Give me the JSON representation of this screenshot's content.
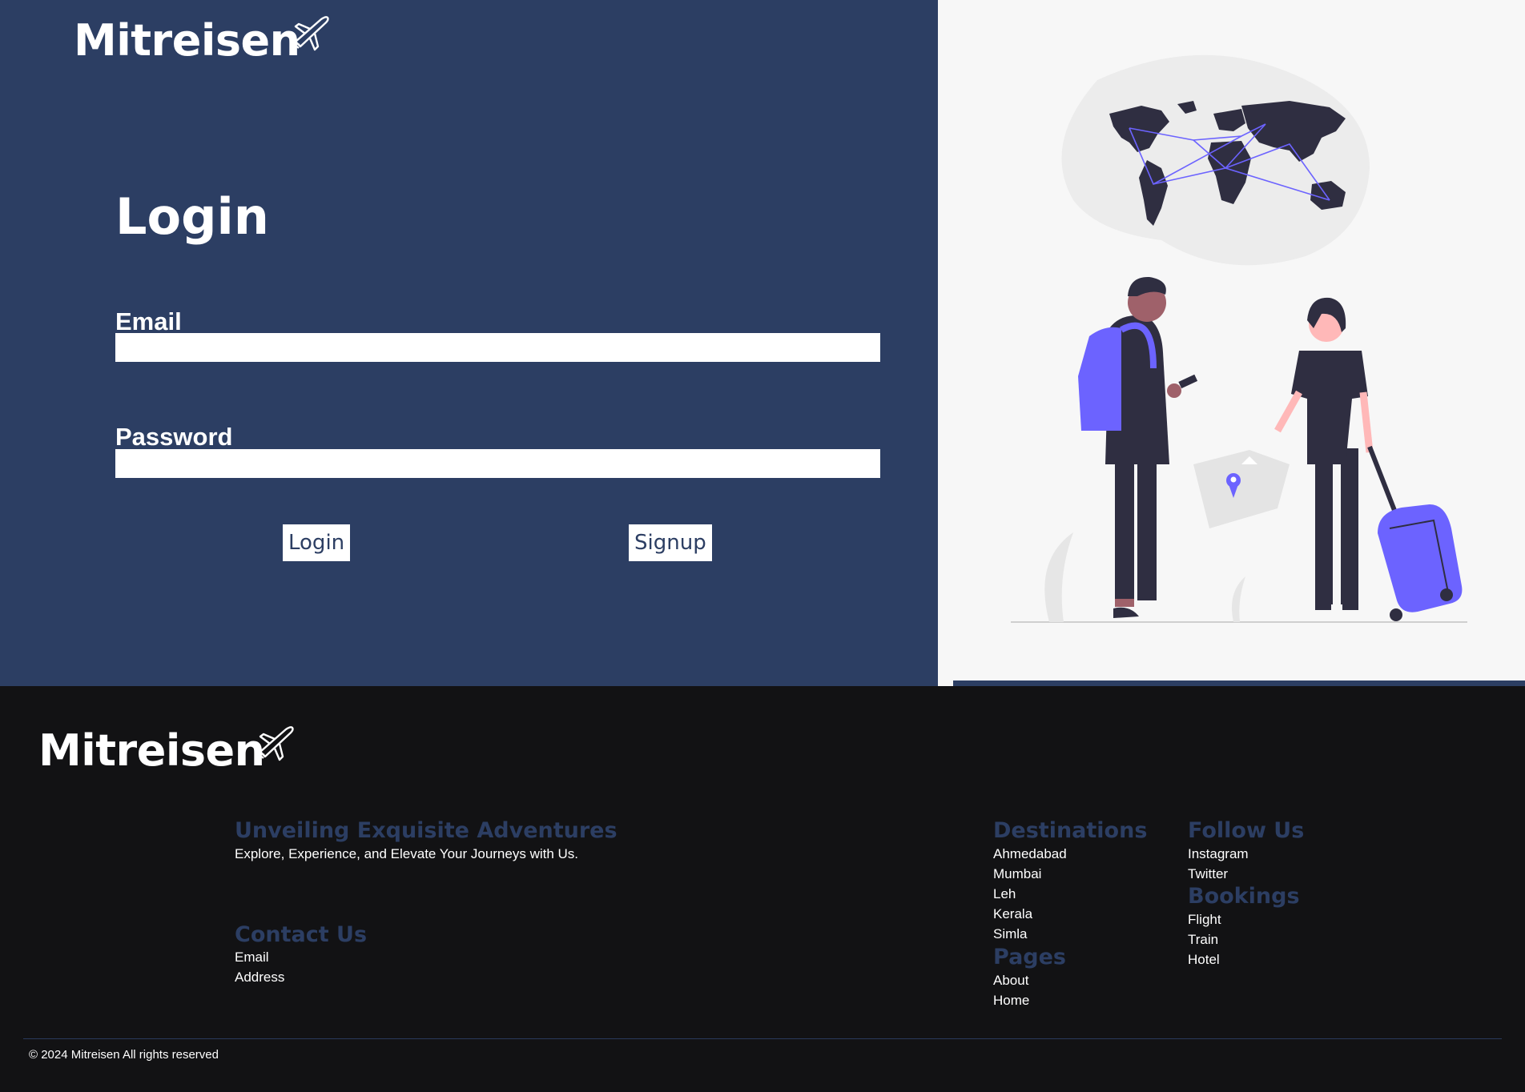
{
  "brand": {
    "name": "Mitreisen"
  },
  "login": {
    "title": "Login",
    "email_label": "Email",
    "email_value": "",
    "password_label": "Password",
    "password_value": "",
    "login_button": "Login",
    "signup_button": "Signup"
  },
  "footer": {
    "tagline_title": "Unveiling Exquisite Adventures",
    "tagline_text": "Explore, Experience, and Elevate Your Journeys with Us.",
    "contact": {
      "title": "Contact Us",
      "items": [
        "Email",
        "Address"
      ]
    },
    "destinations": {
      "title": "Destinations",
      "items": [
        "Ahmedabad",
        "Mumbai",
        "Leh",
        "Kerala",
        "Simla"
      ]
    },
    "pages": {
      "title": "Pages",
      "items": [
        "About",
        "Home"
      ]
    },
    "follow": {
      "title": "Follow Us",
      "items": [
        "Instagram",
        "Twitter"
      ]
    },
    "bookings": {
      "title": "Bookings",
      "items": [
        "Flight",
        "Train",
        "Hotel"
      ]
    },
    "copyright": "© 2024 Mitreisen All rights reserved"
  },
  "colors": {
    "primary": "#2c3e63",
    "footer_bg": "#121214",
    "illustration_accent": "#6c63ff",
    "illustration_dark": "#2f2e41"
  },
  "icons": {
    "brand_icon": "airplane-icon",
    "illustration": "travelers-world-map-illustration"
  }
}
